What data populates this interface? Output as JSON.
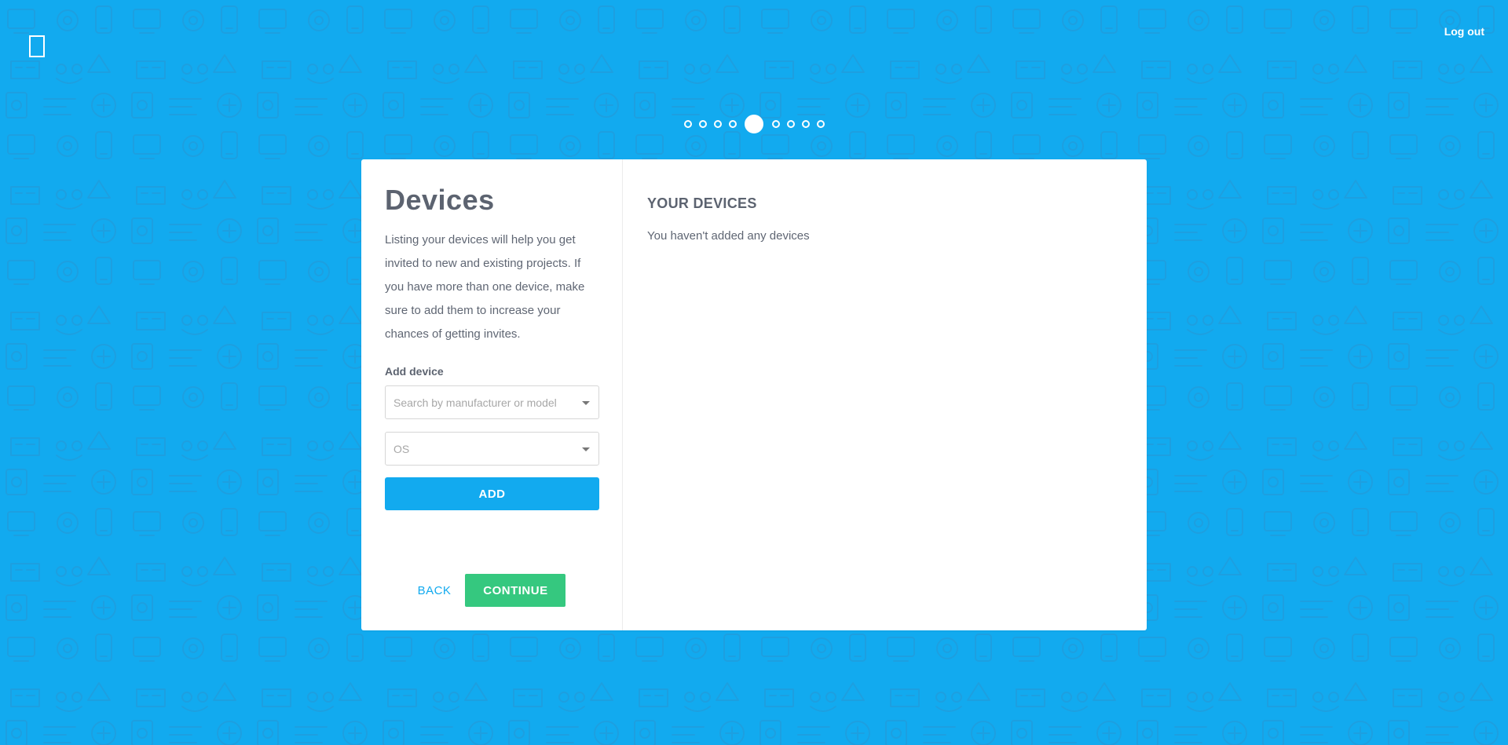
{
  "header": {
    "logout_label": "Log out"
  },
  "stepper": {
    "total_steps": 9,
    "current_step": 5
  },
  "devices_panel": {
    "title": "Devices",
    "description": "Listing your devices will help you get invited to new and existing projects. If you have more than one device, make sure to add them to increase your chances of getting invites.",
    "add_device_label": "Add device",
    "device_search": {
      "value": "",
      "placeholder": "Search by manufacturer or model"
    },
    "os_select": {
      "value": "",
      "placeholder": "OS"
    },
    "add_button_label": "ADD",
    "back_label": "BACK",
    "continue_label": "CONTINUE"
  },
  "your_devices": {
    "title": "YOUR DEVICES",
    "empty_message": "You haven't added any devices"
  },
  "colors": {
    "background": "#12aaef",
    "primary": "#12aaef",
    "success": "#35c87f",
    "text": "#5c6370"
  }
}
